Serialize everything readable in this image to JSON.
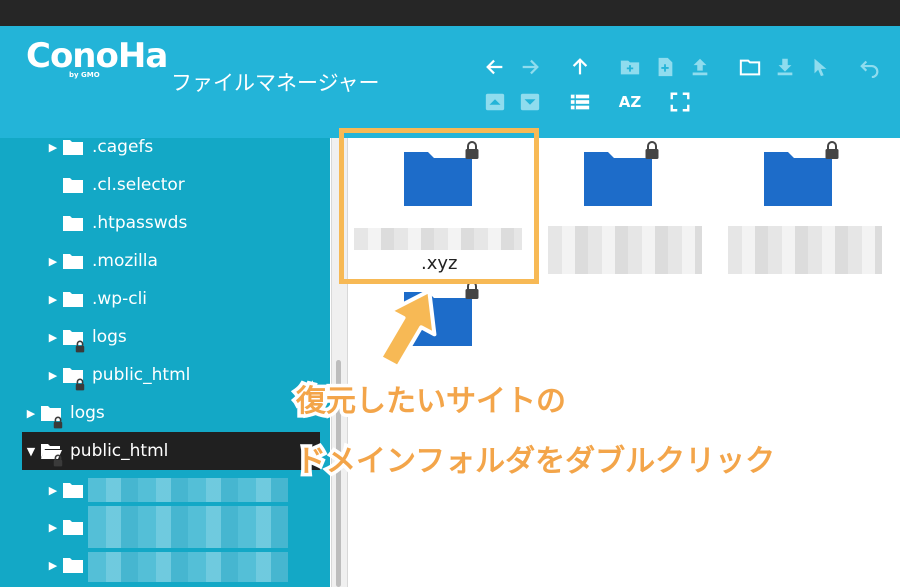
{
  "brand": {
    "logo": "ConoHa",
    "logo_sub": "by GMO",
    "title": "ファイルマネージャー"
  },
  "toolbar": {
    "row1": [
      "back-arrow-icon",
      "forward-arrow-icon",
      "up-arrow-icon",
      "new-folder-icon",
      "new-file-icon",
      "upload-icon",
      "open-folder-icon",
      "download-icon",
      "select-pointer-icon",
      "undo-icon"
    ],
    "row2": [
      "expand-up-icon",
      "collapse-down-icon",
      "list-view-icon",
      "sort-az-icon",
      "fullscreen-icon"
    ],
    "sort_label": "AZ"
  },
  "tree": {
    "items": [
      {
        "label": ".cagefs",
        "expandable": true
      },
      {
        "label": ".cl.selector",
        "expandable": false
      },
      {
        "label": ".htpasswds",
        "expandable": false
      },
      {
        "label": ".mozilla",
        "expandable": true
      },
      {
        "label": ".wp-cli",
        "expandable": true
      },
      {
        "label": "logs",
        "expandable": true,
        "locked": true
      },
      {
        "label": "public_html",
        "expandable": true,
        "locked": true
      },
      {
        "label": "logs",
        "expandable": true,
        "locked": true
      },
      {
        "label": "public_html",
        "expandable": true,
        "expanded": true,
        "selected": true,
        "locked": true
      },
      {
        "label": "",
        "expandable": true
      },
      {
        "label": "",
        "expandable": true
      },
      {
        "label": "",
        "expandable": true
      }
    ]
  },
  "files": [
    {
      "label": ".xyz",
      "locked": true,
      "highlighted": true
    },
    {
      "label": "",
      "locked": true
    },
    {
      "label": "",
      "locked": true
    },
    {
      "label": "",
      "locked": true
    }
  ],
  "annotation": {
    "line1": "復元したいサイトの",
    "line2": "ドメインフォルダをダブルクリック"
  },
  "colors": {
    "header": "#23b4d8",
    "sidebar": "#13a8c6",
    "folder": "#1d6cc9",
    "highlight": "#f7b955",
    "annotation": "#f3a54a"
  }
}
